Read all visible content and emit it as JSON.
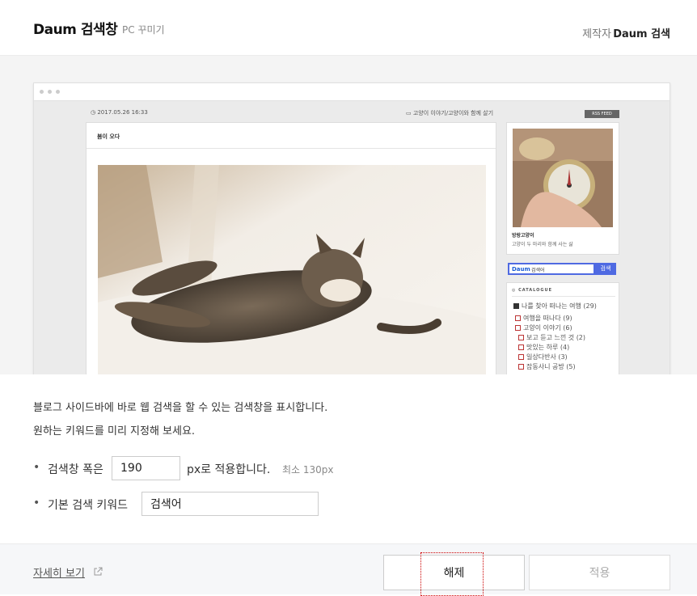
{
  "header": {
    "title": "Daum 검색창",
    "subtitle": "PC 꾸미기",
    "author_label": "제작자",
    "author_name": "Daum 검색"
  },
  "preview": {
    "post_date": "2017.05.26 16:33",
    "post_category": "고양이 이야기/고양이와 함께 살기",
    "rss_label": "RSS FEED",
    "post_title": "봄이 오다",
    "profile_name": "방랑고양이",
    "profile_desc": "고양이 두 마리와 함께 사는 삶",
    "search_logo": "Daum",
    "search_keyword": "검색어",
    "search_button": "검색",
    "catalogue_title": "CATALOGUE",
    "categories": [
      {
        "label": "나를 찾아 떠나는 여행 (29)"
      },
      {
        "label": "여행을 떠나다 (9)"
      },
      {
        "label": "고양이 이야기 (6)"
      },
      {
        "label": "보고 듣고 느낀 것 (2)"
      },
      {
        "label": "맛있는 하루 (4)"
      },
      {
        "label": "일상다반사 (3)"
      },
      {
        "label": "잡동사니 공방 (5)"
      }
    ]
  },
  "description": {
    "line1": "블로그 사이드바에 바로 웹 검색을 할 수 있는 검색창을 표시합니다.",
    "line2": "원하는 키워드를 미리 지정해 보세요."
  },
  "options": {
    "width_label": "검색창 폭은",
    "width_value": "190",
    "width_suffix": "px로 적용합니다.",
    "width_hint": "최소 130px",
    "keyword_label": "기본 검색 키워드",
    "keyword_value": "검색어"
  },
  "footer": {
    "more_link": "자세히 보기",
    "release_button": "해제",
    "apply_button": "적용"
  },
  "colors": {
    "accent": "#4f6ae2",
    "focus_outline": "#cc0000"
  }
}
